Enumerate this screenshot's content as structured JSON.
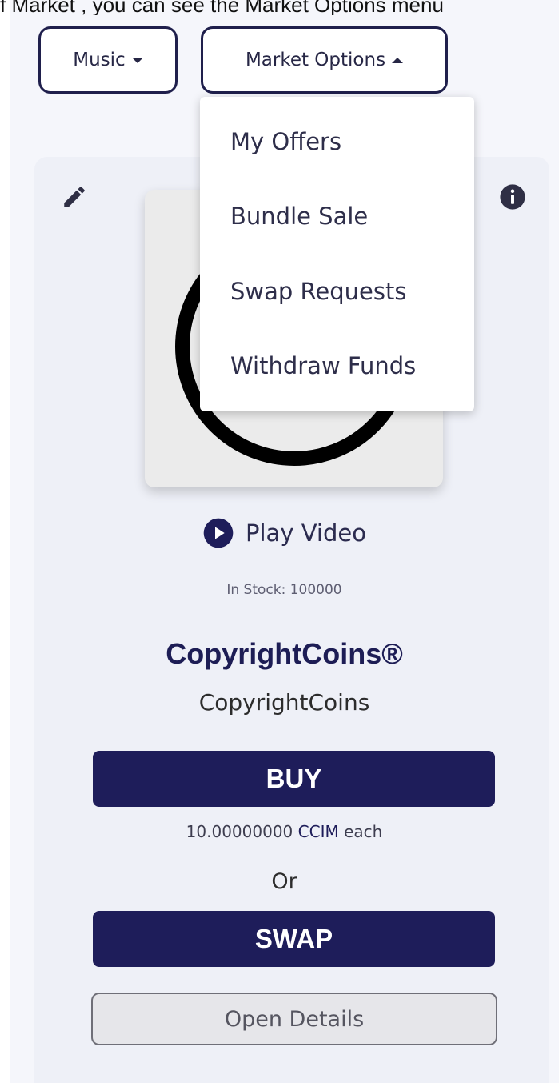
{
  "caption": {
    "text": "f Market , you can see the  Market Options  menu"
  },
  "toolbar": {
    "music_label": "Music",
    "market_options_label": "Market Options"
  },
  "market_menu": {
    "items": [
      {
        "label": "My Offers"
      },
      {
        "label": "Bundle Sale"
      },
      {
        "label": "Swap Requests"
      },
      {
        "label": "Withdraw Funds"
      }
    ]
  },
  "product": {
    "play_video_label": "Play Video",
    "stock_text": "In Stock: 100000",
    "title": "CopyrightCoins®",
    "subtitle": "CopyrightCoins",
    "buy_label": "BUY",
    "price_amount": "10.00000000",
    "price_currency": "CCIM",
    "price_suffix": "each",
    "or_text": "Or",
    "swap_label": "SWAP",
    "open_details_label": "Open Details"
  },
  "icons": {
    "edit": "pencil-icon",
    "info": "info-circle-icon",
    "play": "play-circle-icon",
    "caret_down": "caret-down-icon",
    "caret_up": "caret-up-icon"
  },
  "colors": {
    "brand_navy": "#1e1d5a",
    "card_background": "#eef0f7",
    "page_background": "#f5f6fb",
    "menu_background": "#ffffff"
  }
}
